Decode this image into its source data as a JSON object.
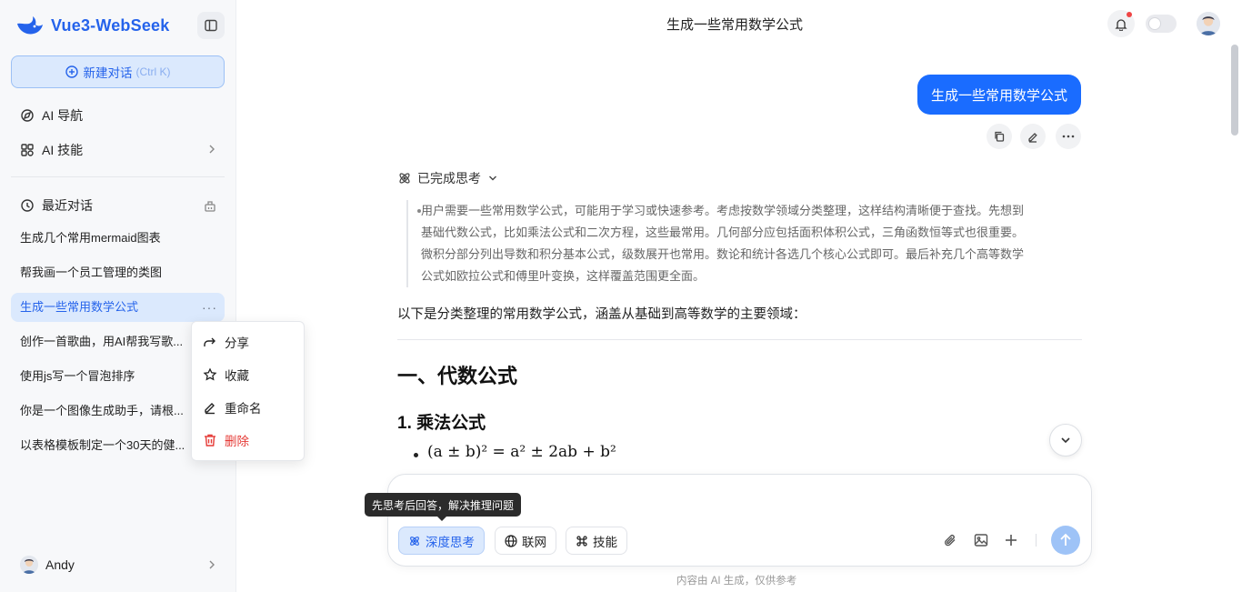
{
  "app": {
    "name": "Vue3-WebSeek",
    "accent": "#2563eb"
  },
  "sidebar": {
    "new_chat_label": "新建对话",
    "new_chat_shortcut": "(Ctrl K)",
    "nav": [
      {
        "label": "AI 导航",
        "icon": "compass-icon"
      },
      {
        "label": "AI 技能",
        "icon": "apps-grid-icon"
      }
    ],
    "recent_header": "最近对话",
    "conversations": [
      {
        "title": "生成几个常用mermaid图表"
      },
      {
        "title": "帮我画一个员工管理的类图"
      },
      {
        "title": "生成一些常用数学公式",
        "active": true
      },
      {
        "title": "创作一首歌曲，用AI帮我写歌..."
      },
      {
        "title": "使用js写一个冒泡排序"
      },
      {
        "title": "你是一个图像生成助手，请根..."
      },
      {
        "title": "以表格模板制定一个30天的健..."
      }
    ],
    "more_label": "···",
    "user_name": "Andy"
  },
  "context_menu": {
    "items": [
      {
        "label": "分享",
        "icon": "share-icon"
      },
      {
        "label": "收藏",
        "icon": "star-icon"
      },
      {
        "label": "重命名",
        "icon": "edit-icon"
      },
      {
        "label": "删除",
        "icon": "trash-icon",
        "danger": true
      }
    ]
  },
  "header": {
    "title": "生成一些常用数学公式"
  },
  "chat": {
    "user_message": "生成一些常用数学公式",
    "thinking_label": "已完成思考",
    "thinking_lines": [
      "用户需要一些常用数学公式，可能用于学习或快速参考。考虑按数学领域分类整理，这样结构清晰便于查找。先想到",
      "基础代数公式，比如乘法公式和二次方程，这些最常用。几何部分应包括面积体积公式，三角函数恒等式也很重要。",
      "微积分部分列出导数和积分基本公式，级数展开也常用。数论和统计各选几个核心公式即可。最后补充几个高等数学",
      "公式如欧拉公式和傅里叶变换，这样覆盖范围更全面。"
    ],
    "intro": "以下是分类整理的常用数学公式，涵盖从基础到高等数学的主要领域：",
    "heading1": "一、代数公式",
    "heading2": "1. 乘法公式",
    "formula": "(a ± b)² = a² ± 2ab + b²"
  },
  "composer": {
    "tooltip": "先思考后回答，解决推理问题",
    "chips": [
      {
        "label": "深度思考",
        "icon": "atom-icon",
        "active": true
      },
      {
        "label": "联网",
        "icon": "globe-icon"
      },
      {
        "label": "技能",
        "icon": "command-icon"
      }
    ],
    "footnote": "内容由 AI 生成，仅供参考"
  }
}
